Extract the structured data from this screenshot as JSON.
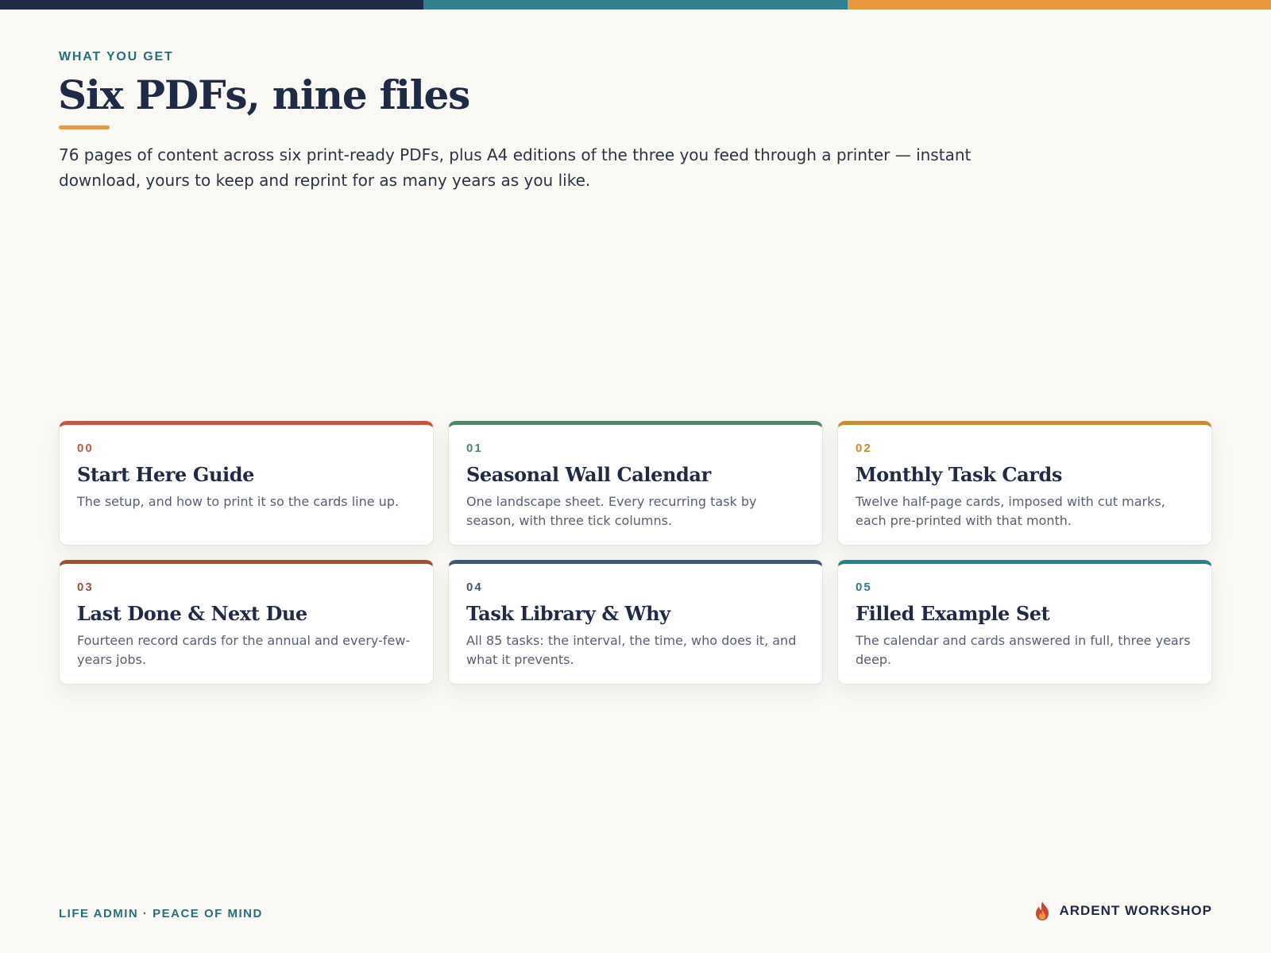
{
  "header": {
    "eyebrow": "WHAT YOU GET",
    "title": "Six PDFs, nine files",
    "intro": "76 pages of content across six print-ready PDFs, plus A4 editions of the three you feed through a printer — instant download, yours to keep and reprint for as many years as you like."
  },
  "colors": {
    "stripe": [
      "#1e2a4a",
      "#2e8190",
      "#e8993c"
    ],
    "accent_rule": "#e8993c"
  },
  "cards": [
    {
      "num": "00",
      "title": "Start Here Guide",
      "desc": "The setup, and how to print it so the cards line up.",
      "color": "#c9563a"
    },
    {
      "num": "01",
      "title": "Seasonal Wall Calendar",
      "desc": "One landscape sheet. Every recurring task by season, with three tick columns.",
      "color": "#4a8a62"
    },
    {
      "num": "02",
      "title": "Monthly Task Cards",
      "desc": "Twelve half-page cards, imposed with cut marks, each pre-printed with that month.",
      "color": "#c98b2c"
    },
    {
      "num": "03",
      "title": "Last Done & Next Due",
      "desc": "Fourteen record cards for the annual and every-few-years jobs.",
      "color": "#9a5530"
    },
    {
      "num": "04",
      "title": "Task Library & Why",
      "desc": "All 85 tasks: the interval, the time, who does it, and what it prevents.",
      "color": "#3b5878"
    },
    {
      "num": "05",
      "title": "Filled Example Set",
      "desc": "The calendar and cards answered in full, three years deep.",
      "color": "#2b7e8a"
    }
  ],
  "footer": {
    "tagline": "LIFE ADMIN · PEACE OF MIND",
    "brand": "ARDENT WORKSHOP",
    "brand_icon": "flame-icon"
  }
}
